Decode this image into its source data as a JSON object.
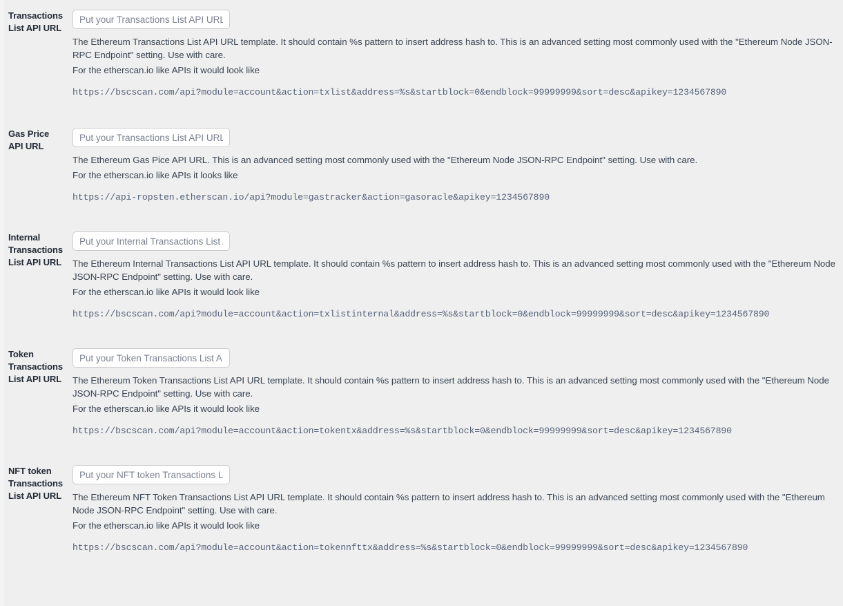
{
  "page": {
    "background_color": "#efefef",
    "label_color": "#232b36",
    "help_color": "#3a4553",
    "code_color": "#55627a",
    "input_border_color": "#ccccd0",
    "input_background": "#ffffff",
    "placeholder_color": "#7b8290"
  },
  "settings": [
    {
      "label": "Transactions List API URL",
      "input_placeholder": "Put your Transactions List API URL here",
      "input_value": "",
      "help_primary": "The Ethereum Transactions List API URL template. It should contain %s pattern to insert address hash to. This is an advanced setting most commonly used with the \"Ethereum Node JSON-RPC Endpoint\" setting. Use with care.",
      "help_secondary": "For the etherscan.io like APIs it would look like",
      "code_example": "https://bscscan.com/api?module=account&action=txlist&address=%s&startblock=0&endblock=99999999&sort=desc&apikey=1234567890"
    },
    {
      "label": "Gas Price API URL",
      "input_placeholder": "Put your Transactions List API URL here",
      "input_value": "",
      "help_primary": "The Ethereum Gas Pice API URL. This is an advanced setting most commonly used with the \"Ethereum Node JSON-RPC Endpoint\" setting. Use with care.",
      "help_secondary": "For the etherscan.io like APIs it looks like",
      "code_example": "https://api-ropsten.etherscan.io/api?module=gastracker&action=gasoracle&apikey=1234567890"
    },
    {
      "label": "Internal Transactions List API URL",
      "input_placeholder": "Put your Internal Transactions List API URL here",
      "input_value": "",
      "help_primary": "The Ethereum Internal Transactions List API URL template. It should contain %s pattern to insert address hash to. This is an advanced setting most commonly used with the \"Ethereum Node JSON-RPC Endpoint\" setting. Use with care.",
      "help_secondary": "For the etherscan.io like APIs it would look like",
      "code_example": "https://bscscan.com/api?module=account&action=txlistinternal&address=%s&startblock=0&endblock=99999999&sort=desc&apikey=1234567890"
    },
    {
      "label": "Token Transactions List API URL",
      "input_placeholder": "Put your Token Transactions List API URL here",
      "input_value": "",
      "help_primary": "The Ethereum Token Transactions List API URL template. It should contain %s pattern to insert address hash to. This is an advanced setting most commonly used with the \"Ethereum Node JSON-RPC Endpoint\" setting. Use with care.",
      "help_secondary": "For the etherscan.io like APIs it would look like",
      "code_example": "https://bscscan.com/api?module=account&action=tokentx&address=%s&startblock=0&endblock=99999999&sort=desc&apikey=1234567890"
    },
    {
      "label": "NFT token Transactions List API URL",
      "input_placeholder": "Put your NFT token Transactions List API URL here",
      "input_value": "",
      "help_primary": "The Ethereum NFT Token Transactions List API URL template. It should contain %s pattern to insert address hash to. This is an advanced setting most commonly used with the \"Ethereum Node JSON-RPC Endpoint\" setting. Use with care.",
      "help_secondary": "For the etherscan.io like APIs it would look like",
      "code_example": "https://bscscan.com/api?module=account&action=tokennfttx&address=%s&startblock=0&endblock=99999999&sort=desc&apikey=1234567890"
    }
  ]
}
